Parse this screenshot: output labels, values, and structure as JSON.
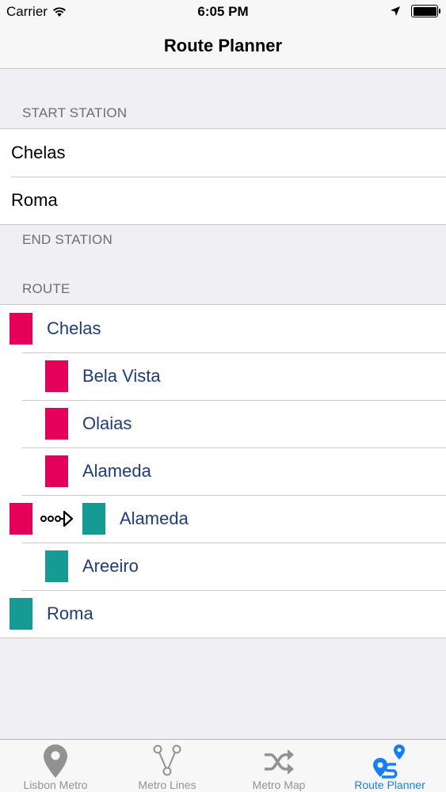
{
  "status_bar": {
    "carrier": "Carrier",
    "time": "6:05 PM",
    "icons": [
      "wifi-icon",
      "location-arrow-icon",
      "battery-icon"
    ]
  },
  "nav": {
    "title": "Route Planner"
  },
  "start_section": {
    "header": "START STATION",
    "rows": [
      "Chelas",
      "Roma"
    ]
  },
  "end_section": {
    "header": "END STATION"
  },
  "route_section": {
    "header": "ROUTE",
    "rows": [
      {
        "label": "Chelas",
        "line_color": "#e5005a",
        "indent": 0
      },
      {
        "label": "Bela Vista",
        "line_color": "#e5005a",
        "indent": 1
      },
      {
        "label": "Olaias",
        "line_color": "#e5005a",
        "indent": 1
      },
      {
        "label": "Alameda",
        "line_color": "#e5005a",
        "indent": 1
      },
      {
        "label": "Alameda",
        "line_color": "#e5005a",
        "transfer_to_color": "#169b94",
        "indent": 0,
        "transfer": true
      },
      {
        "label": "Areeiro",
        "line_color": "#169b94",
        "indent": 1
      },
      {
        "label": "Roma",
        "line_color": "#169b94",
        "indent": 0
      }
    ]
  },
  "tab_bar": {
    "tabs": [
      {
        "label": "Lisbon Metro",
        "icon": "map-pin-icon",
        "active": false
      },
      {
        "label": "Metro Lines",
        "icon": "metro-lines-icon",
        "active": false
      },
      {
        "label": "Metro Map",
        "icon": "shuffle-icon",
        "active": false
      },
      {
        "label": "Route Planner",
        "icon": "route-icon",
        "active": true
      }
    ],
    "active_color": "#157efb",
    "inactive_color": "#929292"
  },
  "colors": {
    "red_line": "#e5005a",
    "green_line": "#169b94",
    "route_text": "#1d3c78"
  }
}
